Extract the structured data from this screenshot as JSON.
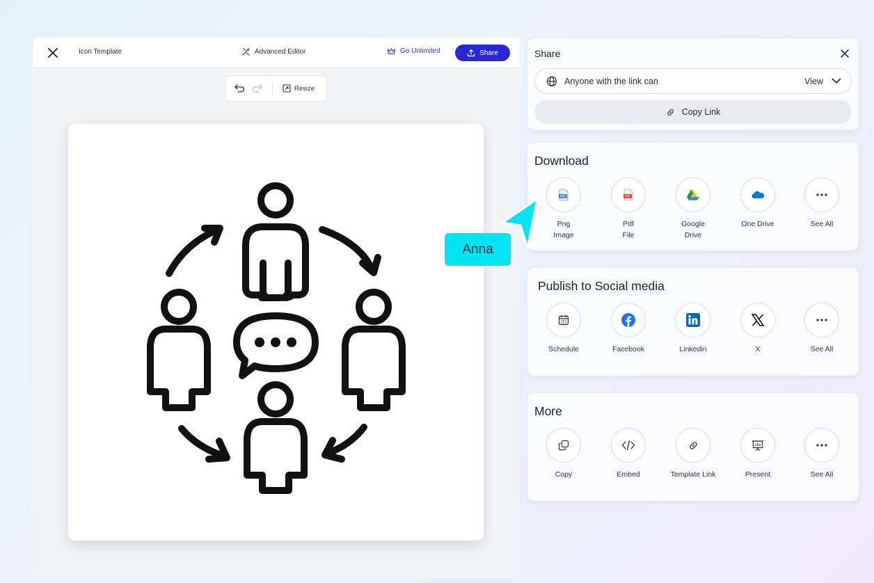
{
  "editor": {
    "title": "Icon Template",
    "advanced_editor_label": "Advanced Editor",
    "go_unlimited_label": "Go Unlimited",
    "share_label": "Share",
    "resize_label": "Resize"
  },
  "share_panel": {
    "title": "Share",
    "access_text": "Anyone with the link can",
    "access_level": "View",
    "copy_link_label": "Copy Link"
  },
  "download": {
    "title": "Download",
    "items": [
      {
        "label": "Png\nImage",
        "icon": "png-file-icon"
      },
      {
        "label": "Pdf\nFile",
        "icon": "pdf-file-icon"
      },
      {
        "label": "Google\nDrive",
        "icon": "google-drive-icon"
      },
      {
        "label": "One Drive",
        "icon": "onedrive-icon"
      },
      {
        "label": "See All",
        "icon": "more-dots-icon"
      }
    ]
  },
  "social": {
    "title": "Publish to Social media",
    "items": [
      {
        "label": "Schedule",
        "icon": "calendar-icon"
      },
      {
        "label": "Facebook",
        "icon": "facebook-icon"
      },
      {
        "label": "Linkedin",
        "icon": "linkedin-icon"
      },
      {
        "label": "X",
        "icon": "x-logo-icon"
      },
      {
        "label": "See All",
        "icon": "more-dots-icon"
      }
    ]
  },
  "more": {
    "title": "More",
    "items": [
      {
        "label": "Copy",
        "icon": "copy-icon"
      },
      {
        "label": "Embed",
        "icon": "code-icon"
      },
      {
        "label": "Template Link",
        "icon": "link-icon"
      },
      {
        "label": "Present",
        "icon": "presentation-icon"
      },
      {
        "label": "See All",
        "icon": "more-dots-icon"
      }
    ]
  },
  "cursor": {
    "user_name": "Anna",
    "color": "#00e5f4"
  },
  "colors": {
    "primary": "#2628d8",
    "unlimited_text": "#2b33c9",
    "facebook": "#1877f2",
    "linkedin": "#0a66c2",
    "onedrive": "#0078d4",
    "pdf": "#e53935"
  }
}
